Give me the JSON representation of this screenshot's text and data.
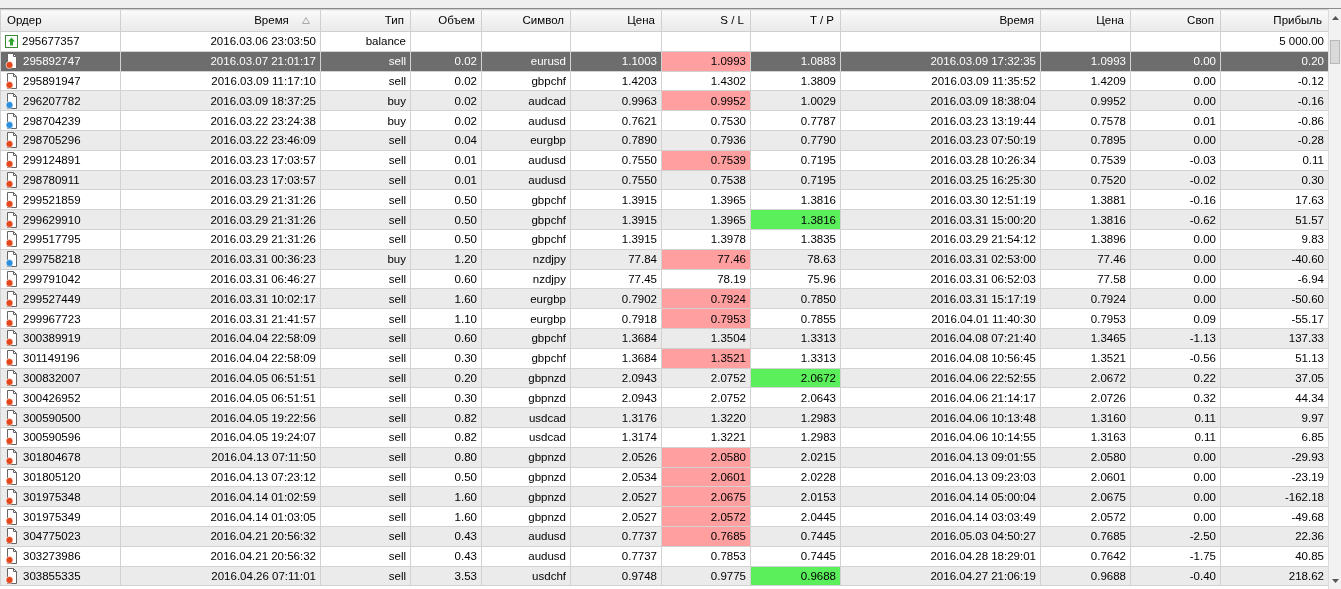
{
  "table": {
    "columns": [
      {
        "label": "Ордер",
        "sorted": false
      },
      {
        "label": "Время",
        "sorted": true
      },
      {
        "label": "Тип",
        "sorted": false
      },
      {
        "label": "Объем",
        "sorted": false
      },
      {
        "label": "Символ",
        "sorted": false
      },
      {
        "label": "Цена",
        "sorted": false
      },
      {
        "label": "S / L",
        "sorted": false
      },
      {
        "label": "T / P",
        "sorted": false
      },
      {
        "label": "Время",
        "sorted": false
      },
      {
        "label": "Цена",
        "sorted": false
      },
      {
        "label": "Своп",
        "sorted": false
      },
      {
        "label": "Прибыль",
        "sorted": false
      }
    ],
    "rows": [
      {
        "kind": "balance",
        "order": "295677357",
        "open_time": "2016.03.06 23:03:50",
        "type": "balance",
        "profit": "5 000.00",
        "selected": false,
        "sl_hit": false,
        "tp_hit": false
      },
      {
        "kind": "sell",
        "order": "295892747",
        "open_time": "2016.03.07 21:01:17",
        "type": "sell",
        "volume": "0.02",
        "symbol": "eurusd",
        "open_price": "1.1003",
        "sl": "1.0993",
        "tp": "1.0883",
        "close_time": "2016.03.09 17:32:35",
        "close_price": "1.0993",
        "swap": "0.00",
        "profit": "0.20",
        "selected": true,
        "sl_hit": true,
        "tp_hit": false
      },
      {
        "kind": "sell",
        "order": "295891947",
        "open_time": "2016.03.09 11:17:10",
        "type": "sell",
        "volume": "0.02",
        "symbol": "gbpchf",
        "open_price": "1.4203",
        "sl": "1.4302",
        "tp": "1.3809",
        "close_time": "2016.03.09 11:35:52",
        "close_price": "1.4209",
        "swap": "0.00",
        "profit": "-0.12",
        "selected": false,
        "sl_hit": false,
        "tp_hit": false
      },
      {
        "kind": "buy",
        "order": "296207782",
        "open_time": "2016.03.09 18:37:25",
        "type": "buy",
        "volume": "0.02",
        "symbol": "audcad",
        "open_price": "0.9963",
        "sl": "0.9952",
        "tp": "1.0029",
        "close_time": "2016.03.09 18:38:04",
        "close_price": "0.9952",
        "swap": "0.00",
        "profit": "-0.16",
        "selected": false,
        "sl_hit": true,
        "tp_hit": false
      },
      {
        "kind": "buy",
        "order": "298704239",
        "open_time": "2016.03.22 23:24:38",
        "type": "buy",
        "volume": "0.02",
        "symbol": "audusd",
        "open_price": "0.7621",
        "sl": "0.7530",
        "tp": "0.7787",
        "close_time": "2016.03.23 13:19:44",
        "close_price": "0.7578",
        "swap": "0.01",
        "profit": "-0.86",
        "selected": false,
        "sl_hit": false,
        "tp_hit": false
      },
      {
        "kind": "sell",
        "order": "298705296",
        "open_time": "2016.03.22 23:46:09",
        "type": "sell",
        "volume": "0.04",
        "symbol": "eurgbp",
        "open_price": "0.7890",
        "sl": "0.7936",
        "tp": "0.7790",
        "close_time": "2016.03.23 07:50:19",
        "close_price": "0.7895",
        "swap": "0.00",
        "profit": "-0.28",
        "selected": false,
        "sl_hit": false,
        "tp_hit": false
      },
      {
        "kind": "sell",
        "order": "299124891",
        "open_time": "2016.03.23 17:03:57",
        "type": "sell",
        "volume": "0.01",
        "symbol": "audusd",
        "open_price": "0.7550",
        "sl": "0.7539",
        "tp": "0.7195",
        "close_time": "2016.03.28 10:26:34",
        "close_price": "0.7539",
        "swap": "-0.03",
        "profit": "0.11",
        "selected": false,
        "sl_hit": true,
        "tp_hit": false
      },
      {
        "kind": "sell",
        "order": "298780911",
        "open_time": "2016.03.23 17:03:57",
        "type": "sell",
        "volume": "0.01",
        "symbol": "audusd",
        "open_price": "0.7550",
        "sl": "0.7538",
        "tp": "0.7195",
        "close_time": "2016.03.25 16:25:30",
        "close_price": "0.7520",
        "swap": "-0.02",
        "profit": "0.30",
        "selected": false,
        "sl_hit": false,
        "tp_hit": false
      },
      {
        "kind": "sell",
        "order": "299521859",
        "open_time": "2016.03.29 21:31:26",
        "type": "sell",
        "volume": "0.50",
        "symbol": "gbpchf",
        "open_price": "1.3915",
        "sl": "1.3965",
        "tp": "1.3816",
        "close_time": "2016.03.30 12:51:19",
        "close_price": "1.3881",
        "swap": "-0.16",
        "profit": "17.63",
        "selected": false,
        "sl_hit": false,
        "tp_hit": false
      },
      {
        "kind": "sell",
        "order": "299629910",
        "open_time": "2016.03.29 21:31:26",
        "type": "sell",
        "volume": "0.50",
        "symbol": "gbpchf",
        "open_price": "1.3915",
        "sl": "1.3965",
        "tp": "1.3816",
        "close_time": "2016.03.31 15:00:20",
        "close_price": "1.3816",
        "swap": "-0.62",
        "profit": "51.57",
        "selected": false,
        "sl_hit": false,
        "tp_hit": true
      },
      {
        "kind": "sell",
        "order": "299517795",
        "open_time": "2016.03.29 21:31:26",
        "type": "sell",
        "volume": "0.50",
        "symbol": "gbpchf",
        "open_price": "1.3915",
        "sl": "1.3978",
        "tp": "1.3835",
        "close_time": "2016.03.29 21:54:12",
        "close_price": "1.3896",
        "swap": "0.00",
        "profit": "9.83",
        "selected": false,
        "sl_hit": false,
        "tp_hit": false
      },
      {
        "kind": "buy",
        "order": "299758218",
        "open_time": "2016.03.31 00:36:23",
        "type": "buy",
        "volume": "1.20",
        "symbol": "nzdjpy",
        "open_price": "77.84",
        "sl": "77.46",
        "tp": "78.63",
        "close_time": "2016.03.31 02:53:00",
        "close_price": "77.46",
        "swap": "0.00",
        "profit": "-40.60",
        "selected": false,
        "sl_hit": true,
        "tp_hit": false
      },
      {
        "kind": "sell",
        "order": "299791042",
        "open_time": "2016.03.31 06:46:27",
        "type": "sell",
        "volume": "0.60",
        "symbol": "nzdjpy",
        "open_price": "77.45",
        "sl": "78.19",
        "tp": "75.96",
        "close_time": "2016.03.31 06:52:03",
        "close_price": "77.58",
        "swap": "0.00",
        "profit": "-6.94",
        "selected": false,
        "sl_hit": false,
        "tp_hit": false
      },
      {
        "kind": "sell",
        "order": "299527449",
        "open_time": "2016.03.31 10:02:17",
        "type": "sell",
        "volume": "1.60",
        "symbol": "eurgbp",
        "open_price": "0.7902",
        "sl": "0.7924",
        "tp": "0.7850",
        "close_time": "2016.03.31 15:17:19",
        "close_price": "0.7924",
        "swap": "0.00",
        "profit": "-50.60",
        "selected": false,
        "sl_hit": true,
        "tp_hit": false
      },
      {
        "kind": "sell",
        "order": "299967723",
        "open_time": "2016.03.31 21:41:57",
        "type": "sell",
        "volume": "1.10",
        "symbol": "eurgbp",
        "open_price": "0.7918",
        "sl": "0.7953",
        "tp": "0.7855",
        "close_time": "2016.04.01 11:40:30",
        "close_price": "0.7953",
        "swap": "0.09",
        "profit": "-55.17",
        "selected": false,
        "sl_hit": true,
        "tp_hit": false
      },
      {
        "kind": "sell",
        "order": "300389919",
        "open_time": "2016.04.04 22:58:09",
        "type": "sell",
        "volume": "0.60",
        "symbol": "gbpchf",
        "open_price": "1.3684",
        "sl": "1.3504",
        "tp": "1.3313",
        "close_time": "2016.04.08 07:21:40",
        "close_price": "1.3465",
        "swap": "-1.13",
        "profit": "137.33",
        "selected": false,
        "sl_hit": false,
        "tp_hit": false
      },
      {
        "kind": "sell",
        "order": "301149196",
        "open_time": "2016.04.04 22:58:09",
        "type": "sell",
        "volume": "0.30",
        "symbol": "gbpchf",
        "open_price": "1.3684",
        "sl": "1.3521",
        "tp": "1.3313",
        "close_time": "2016.04.08 10:56:45",
        "close_price": "1.3521",
        "swap": "-0.56",
        "profit": "51.13",
        "selected": false,
        "sl_hit": true,
        "tp_hit": false
      },
      {
        "kind": "sell",
        "order": "300832007",
        "open_time": "2016.04.05 06:51:51",
        "type": "sell",
        "volume": "0.20",
        "symbol": "gbpnzd",
        "open_price": "2.0943",
        "sl": "2.0752",
        "tp": "2.0672",
        "close_time": "2016.04.06 22:52:55",
        "close_price": "2.0672",
        "swap": "0.22",
        "profit": "37.05",
        "selected": false,
        "sl_hit": false,
        "tp_hit": true
      },
      {
        "kind": "sell",
        "order": "300426952",
        "open_time": "2016.04.05 06:51:51",
        "type": "sell",
        "volume": "0.30",
        "symbol": "gbpnzd",
        "open_price": "2.0943",
        "sl": "2.0752",
        "tp": "2.0643",
        "close_time": "2016.04.06 21:14:17",
        "close_price": "2.0726",
        "swap": "0.32",
        "profit": "44.34",
        "selected": false,
        "sl_hit": false,
        "tp_hit": false
      },
      {
        "kind": "sell",
        "order": "300590500",
        "open_time": "2016.04.05 19:22:56",
        "type": "sell",
        "volume": "0.82",
        "symbol": "usdcad",
        "open_price": "1.3176",
        "sl": "1.3220",
        "tp": "1.2983",
        "close_time": "2016.04.06 10:13:48",
        "close_price": "1.3160",
        "swap": "0.11",
        "profit": "9.97",
        "selected": false,
        "sl_hit": false,
        "tp_hit": false
      },
      {
        "kind": "sell",
        "order": "300590596",
        "open_time": "2016.04.05 19:24:07",
        "type": "sell",
        "volume": "0.82",
        "symbol": "usdcad",
        "open_price": "1.3174",
        "sl": "1.3221",
        "tp": "1.2983",
        "close_time": "2016.04.06 10:14:55",
        "close_price": "1.3163",
        "swap": "0.11",
        "profit": "6.85",
        "selected": false,
        "sl_hit": false,
        "tp_hit": false
      },
      {
        "kind": "sell",
        "order": "301804678",
        "open_time": "2016.04.13 07:11:50",
        "type": "sell",
        "volume": "0.80",
        "symbol": "gbpnzd",
        "open_price": "2.0526",
        "sl": "2.0580",
        "tp": "2.0215",
        "close_time": "2016.04.13 09:01:55",
        "close_price": "2.0580",
        "swap": "0.00",
        "profit": "-29.93",
        "selected": false,
        "sl_hit": true,
        "tp_hit": false
      },
      {
        "kind": "sell",
        "order": "301805120",
        "open_time": "2016.04.13 07:23:12",
        "type": "sell",
        "volume": "0.50",
        "symbol": "gbpnzd",
        "open_price": "2.0534",
        "sl": "2.0601",
        "tp": "2.0228",
        "close_time": "2016.04.13 09:23:03",
        "close_price": "2.0601",
        "swap": "0.00",
        "profit": "-23.19",
        "selected": false,
        "sl_hit": true,
        "tp_hit": false
      },
      {
        "kind": "sell",
        "order": "301975348",
        "open_time": "2016.04.14 01:02:59",
        "type": "sell",
        "volume": "1.60",
        "symbol": "gbpnzd",
        "open_price": "2.0527",
        "sl": "2.0675",
        "tp": "2.0153",
        "close_time": "2016.04.14 05:00:04",
        "close_price": "2.0675",
        "swap": "0.00",
        "profit": "-162.18",
        "selected": false,
        "sl_hit": true,
        "tp_hit": false
      },
      {
        "kind": "sell",
        "order": "301975349",
        "open_time": "2016.04.14 01:03:05",
        "type": "sell",
        "volume": "1.60",
        "symbol": "gbpnzd",
        "open_price": "2.0527",
        "sl": "2.0572",
        "tp": "2.0445",
        "close_time": "2016.04.14 03:03:49",
        "close_price": "2.0572",
        "swap": "0.00",
        "profit": "-49.68",
        "selected": false,
        "sl_hit": true,
        "tp_hit": false
      },
      {
        "kind": "sell",
        "order": "304775023",
        "open_time": "2016.04.21 20:56:32",
        "type": "sell",
        "volume": "0.43",
        "symbol": "audusd",
        "open_price": "0.7737",
        "sl": "0.7685",
        "tp": "0.7445",
        "close_time": "2016.05.03 04:50:27",
        "close_price": "0.7685",
        "swap": "-2.50",
        "profit": "22.36",
        "selected": false,
        "sl_hit": true,
        "tp_hit": false
      },
      {
        "kind": "sell",
        "order": "303273986",
        "open_time": "2016.04.21 20:56:32",
        "type": "sell",
        "volume": "0.43",
        "symbol": "audusd",
        "open_price": "0.7737",
        "sl": "0.7853",
        "tp": "0.7445",
        "close_time": "2016.04.28 18:29:01",
        "close_price": "0.7642",
        "swap": "-1.75",
        "profit": "40.85",
        "selected": false,
        "sl_hit": false,
        "tp_hit": false
      },
      {
        "kind": "sell",
        "order": "303855335",
        "open_time": "2016.04.26 07:11:01",
        "type": "sell",
        "volume": "3.53",
        "symbol": "usdchf",
        "open_price": "0.9748",
        "sl": "0.9775",
        "tp": "0.9688",
        "close_time": "2016.04.27 21:06:19",
        "close_price": "0.9688",
        "swap": "-0.40",
        "profit": "218.62",
        "selected": false,
        "sl_hit": false,
        "tp_hit": true
      }
    ]
  }
}
